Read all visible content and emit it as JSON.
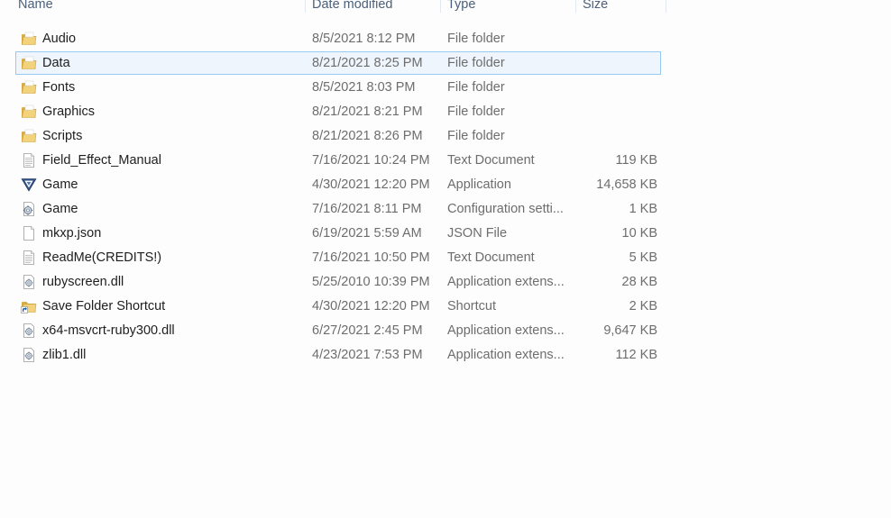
{
  "columns": {
    "name": "Name",
    "date": "Date modified",
    "type": "Type",
    "size": "Size"
  },
  "files": [
    {
      "name": "Audio",
      "date": "8/5/2021 8:12 PM",
      "type": "File folder",
      "size": "",
      "icon": "folder-icon"
    },
    {
      "name": "Data",
      "date": "8/21/2021 8:25 PM",
      "type": "File folder",
      "size": "",
      "icon": "folder-icon",
      "selected": true
    },
    {
      "name": "Fonts",
      "date": "8/5/2021 8:03 PM",
      "type": "File folder",
      "size": "",
      "icon": "folder-icon"
    },
    {
      "name": "Graphics",
      "date": "8/21/2021 8:21 PM",
      "type": "File folder",
      "size": "",
      "icon": "folder-icon"
    },
    {
      "name": "Scripts",
      "date": "8/21/2021 8:26 PM",
      "type": "File folder",
      "size": "",
      "icon": "folder-icon"
    },
    {
      "name": "Field_Effect_Manual",
      "date": "7/16/2021 10:24 PM",
      "type": "Text Document",
      "size": "119 KB",
      "icon": "text-document-icon"
    },
    {
      "name": "Game",
      "date": "4/30/2021 12:20 PM",
      "type": "Application",
      "size": "14,658 KB",
      "icon": "application-icon"
    },
    {
      "name": "Game",
      "date": "7/16/2021 8:11 PM",
      "type": "Configuration setti...",
      "size": "1 KB",
      "icon": "config-settings-icon"
    },
    {
      "name": "mkxp.json",
      "date": "6/19/2021 5:59 AM",
      "type": "JSON File",
      "size": "10 KB",
      "icon": "blank-file-icon"
    },
    {
      "name": "ReadMe(CREDITS!)",
      "date": "7/16/2021 10:50 PM",
      "type": "Text Document",
      "size": "5 KB",
      "icon": "text-document-icon"
    },
    {
      "name": "rubyscreen.dll",
      "date": "5/25/2010 10:39 PM",
      "type": "Application extens...",
      "size": "28 KB",
      "icon": "dll-icon"
    },
    {
      "name": "Save Folder Shortcut",
      "date": "4/30/2021 12:20 PM",
      "type": "Shortcut",
      "size": "2 KB",
      "icon": "folder-shortcut-icon"
    },
    {
      "name": "x64-msvcrt-ruby300.dll",
      "date": "6/27/2021 2:45 PM",
      "type": "Application extens...",
      "size": "9,647 KB",
      "icon": "dll-icon"
    },
    {
      "name": "zlib1.dll",
      "date": "4/23/2021 7:53 PM",
      "type": "Application extens...",
      "size": "112 KB",
      "icon": "dll-icon"
    }
  ],
  "colors": {
    "selection_bg": "#eef5fd",
    "selection_border": "#99c9ef",
    "header_text": "#4c607a",
    "detail_text": "#6d6d6d",
    "folder": "#e8c46a"
  }
}
